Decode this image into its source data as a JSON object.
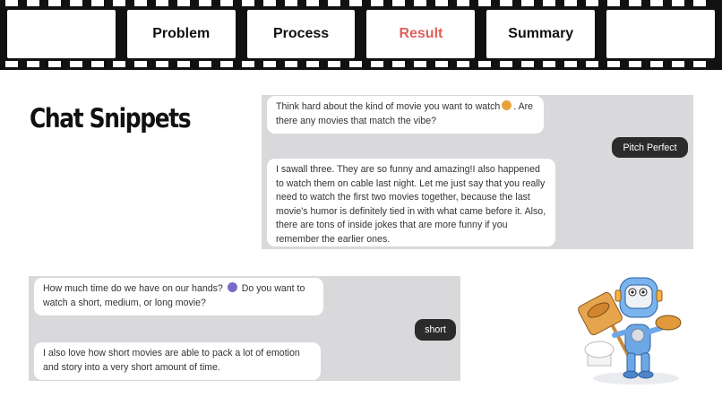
{
  "nav": {
    "tabs": [
      {
        "label": ""
      },
      {
        "label": "Problem"
      },
      {
        "label": "Process"
      },
      {
        "label": "Result"
      },
      {
        "label": "Summary"
      },
      {
        "label": ""
      }
    ],
    "active_tab": "Result",
    "active_color": "#e0605a"
  },
  "heading": "Chat Snippets",
  "chat1": {
    "bot_message_1": "Think hard about the kind of movie you want to watch",
    "bot_message_1_end": ". Are there any movies that match the vibe?",
    "bot_message_1_emoji": "thinking-face-icon",
    "user_message": "Pitch Perfect",
    "bot_message_2": "I sawall three. They are so funny and amazing!I also happened to watch them on cable last night. Let me just say that you really need to watch the first two movies together, because the last movie's humor is definitely tied in with what came before it. Also, there are tons of inside jokes that are more funny if you remember the earlier ones."
  },
  "chat2": {
    "bot_message_1": "How much time do we have on our hands?",
    "bot_message_1_end": "Do you want to watch a short, medium, or long movie?",
    "bot_message_1_emoji": "stopwatch-icon",
    "user_message": "short",
    "bot_message_2": "I also love how short movies are able to pack a lot of emotion and story into a very short amount of time."
  },
  "mascot": {
    "icon": "robot-chef-mascot-icon"
  },
  "colors": {
    "panel_bg": "#d9d9dc",
    "user_bubble_bg": "#2b2b2b",
    "film_strip": "#111111"
  }
}
